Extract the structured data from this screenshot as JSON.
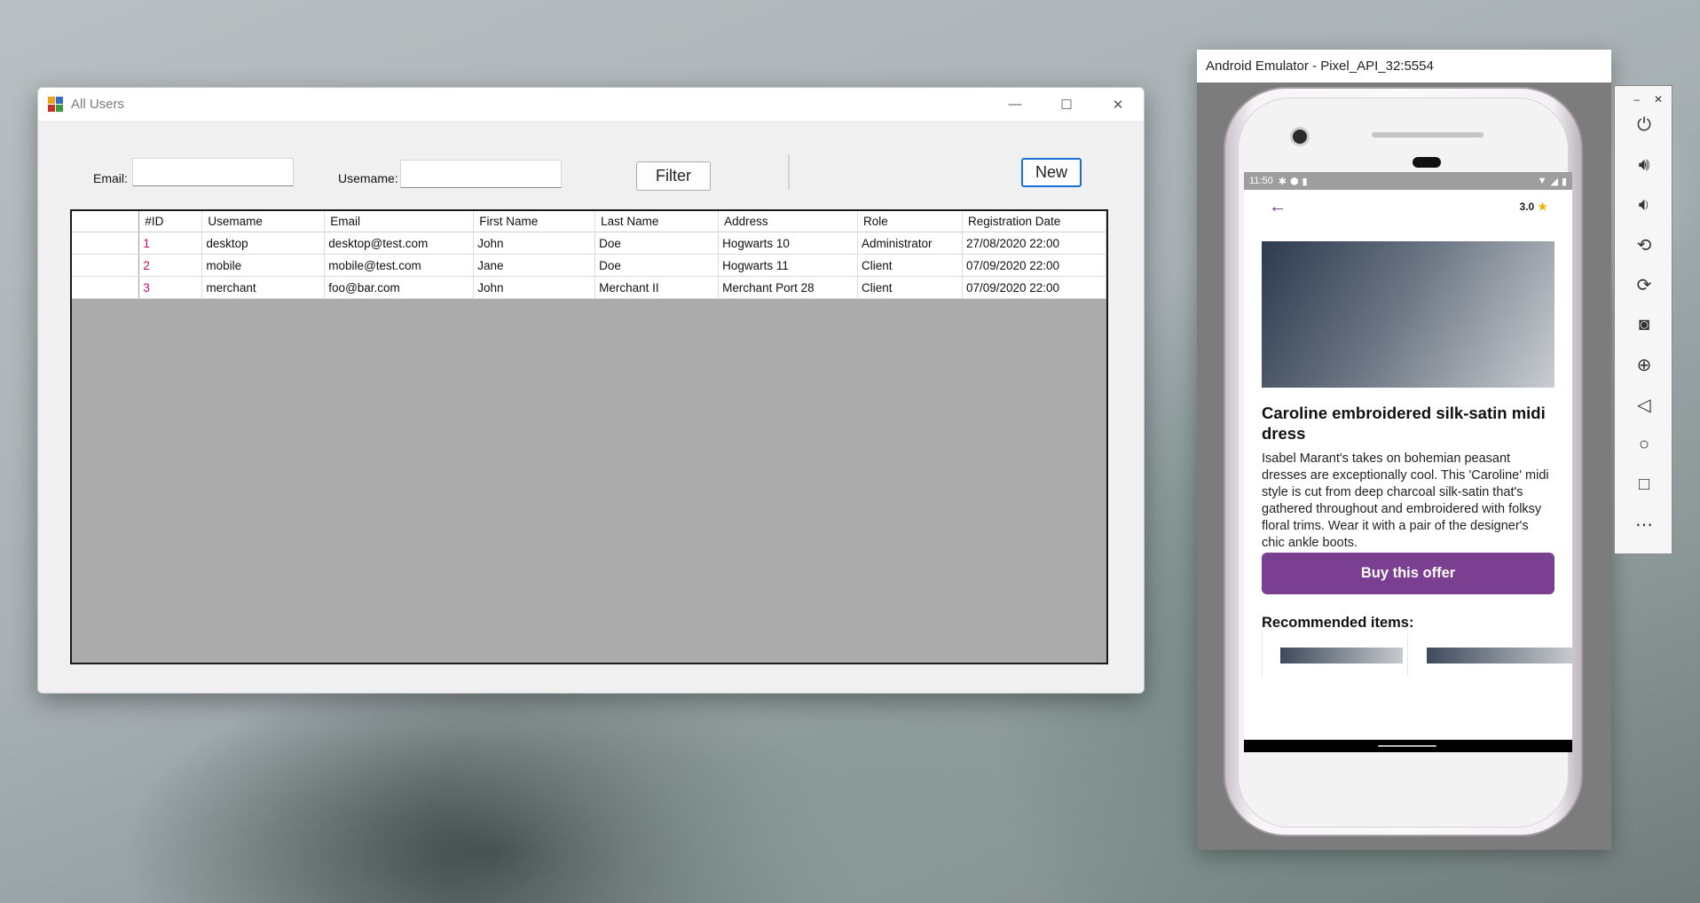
{
  "winform": {
    "title": "All Users",
    "controls": {
      "minimize": "—",
      "maximize": "☐",
      "close": "✕"
    },
    "filter": {
      "email_label": "Email:",
      "email_value": "",
      "username_label": "Usemame:",
      "username_value": "",
      "filter_button": "Filter",
      "new_button": "New"
    },
    "grid": {
      "columns": [
        "#ID",
        "Usemame",
        "Email",
        "First Name",
        "Last Name",
        "Address",
        "Role",
        "Registration Date"
      ],
      "rows": [
        [
          "1",
          "desktop",
          "desktop@test.com",
          "John",
          "Doe",
          "Hogwarts 10",
          "Administrator",
          "27/08/2020 22:00"
        ],
        [
          "2",
          "mobile",
          "mobile@test.com",
          "Jane",
          "Doe",
          "Hogwarts 11",
          "Client",
          "07/09/2020 22:00"
        ],
        [
          "3",
          "merchant",
          "foo@bar.com",
          "John",
          "Merchant II",
          "Merchant Port 28",
          "Client",
          "07/09/2020 22:00"
        ]
      ]
    }
  },
  "emulator": {
    "title": "Android Emulator - Pixel_API_32:5554",
    "status_time": "11:50",
    "rating": "3.0",
    "product_title": "Caroline embroidered silk-satin midi dress",
    "product_description": "Isabel Marant's takes on bohemian peasant dresses are exceptionally cool. This 'Caroline' midi style is cut from deep charcoal silk-satin that's gathered throughout and embroidered with folksy floral trims. Wear it with a pair of the designer's chic ankle boots.",
    "buy_button": "Buy this offer",
    "recommended_heading": "Recommended items:",
    "accent_color": "#7b3f91",
    "side_controls": [
      "power-icon",
      "volume-up-icon",
      "volume-down-icon",
      "rotate-left-icon",
      "rotate-right-icon",
      "camera-icon",
      "zoom-icon",
      "back-icon",
      "home-icon",
      "overview-icon",
      "more-icon"
    ]
  }
}
